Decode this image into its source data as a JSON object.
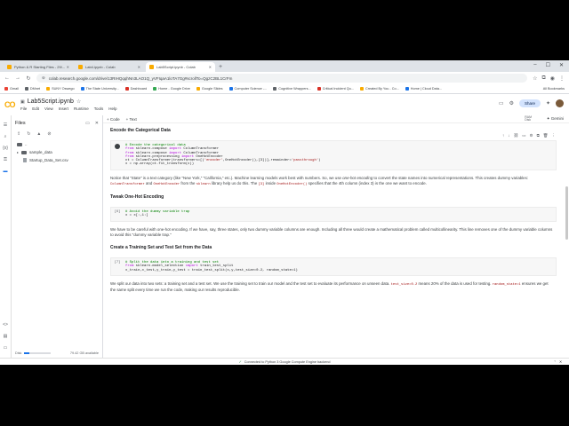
{
  "browser": {
    "tabs": [
      {
        "label": "Python & R Starting Files - 29/...",
        "active": false
      },
      {
        "label": "Lab4.ipynb - Colab",
        "active": false
      },
      {
        "label": "Lab5Script.ipynb - Colab",
        "active": true
      }
    ],
    "url": "colab.research.google.com/drive/13RIHQqqhNn3LAO1Q_yVFIqaA1loTA7Gg#scrollTo=QgzC2BL1CrFm",
    "bookmarks": [
      "Gmail",
      "DMnet",
      "SUNY Oswego",
      "The State University...",
      "Dashboard",
      "Home - Google Drive",
      "Google Slides",
      "Computer Science -...",
      "Cognitive Wrappers...",
      "Critical Incident Qu...",
      "Created By You - Co...",
      "Home | Cloud Data..."
    ],
    "all_bookmarks": "All Bookmarks"
  },
  "colab": {
    "logo": "CO",
    "notebook_title": "Lab5Script.ipynb",
    "menu": [
      "File",
      "Edit",
      "View",
      "Insert",
      "Runtime",
      "Tools",
      "Help"
    ],
    "share": "Share",
    "toolbar": {
      "code": "+ Code",
      "text": "+ Text",
      "ram": "RAM",
      "disk": "Disk",
      "gemini": "Gemini"
    }
  },
  "files": {
    "title": "Files",
    "items": [
      {
        "name": "..",
        "type": "folder"
      },
      {
        "name": "sample_data",
        "type": "folder"
      },
      {
        "name": "Startup_Data_Set.csv",
        "type": "file"
      }
    ],
    "disk_label": "Disk",
    "disk_free": "79.42 GB available",
    "disk_used_fraction": 0.18
  },
  "notebook": {
    "h_encode": "Encode the Categorical Data",
    "p_encode": {
      "a": "Notice that \"State\" is a text category (like \"New York,\" \"California,\" etc.). Machine learning models work best with numbers. So, we use ",
      "em": "one-hot encoding",
      "b": " to convert the state names into numerical representations. This creates dummy variables: ",
      "code1": "ColumnTransformer",
      "c": " and ",
      "code2": "OneHotEncoder",
      "d": " from the ",
      "code3": "sklearn",
      "e": " library help us do this. The ",
      "code4": "[3]",
      "f": " inside ",
      "code5": "OneHotEncoder()",
      "g": " specifies that the 4th column (index 3) is the one we want to encode."
    },
    "h_trap": "Tweak One-Hot Encoding",
    "cell_trap_num": "[6]",
    "p_trap": "We have to be careful with one-hot encoding. If we have, say, three states, only two dummy variable columns are enough. Including all three would create a mathematical problem called multicollinearity. This line removes one of the dummy variable columns to avoid this \"dummy variable trap.\"",
    "h_split": "Create a Training Set and Test Set from the Data",
    "cell_split_num": "[7]",
    "p_split": {
      "a": "We split our data into two sets: a training set and a test set. We use the training set to train our model and the test set to evaluate its performance on unseen data. ",
      "code1": "test_size=0.2",
      "b": " means 20% of the data is used for testing. ",
      "code2": "random_state=1",
      "c": " ensures we get the same split every time we run the code, making our results reproducible."
    }
  },
  "statusbar": {
    "text": "Connected to Python 3 Google Compute Engine backend"
  }
}
